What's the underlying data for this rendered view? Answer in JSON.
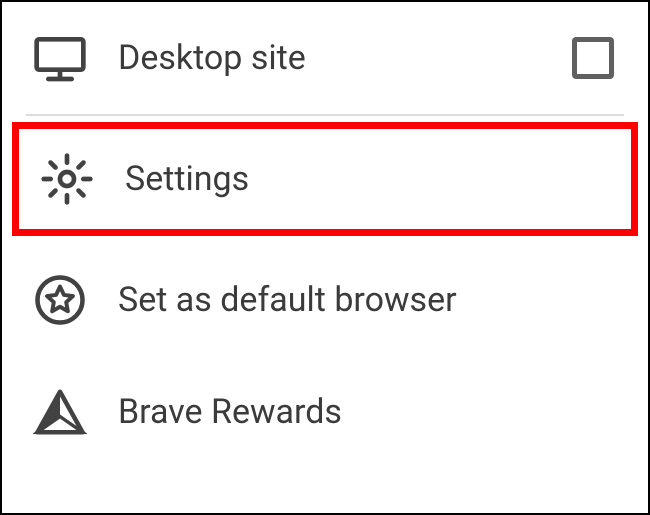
{
  "menu": {
    "desktop_site": {
      "label": "Desktop site"
    },
    "settings": {
      "label": "Settings"
    },
    "default_browser": {
      "label": "Set as default browser"
    },
    "brave_rewards": {
      "label": "Brave Rewards"
    }
  }
}
